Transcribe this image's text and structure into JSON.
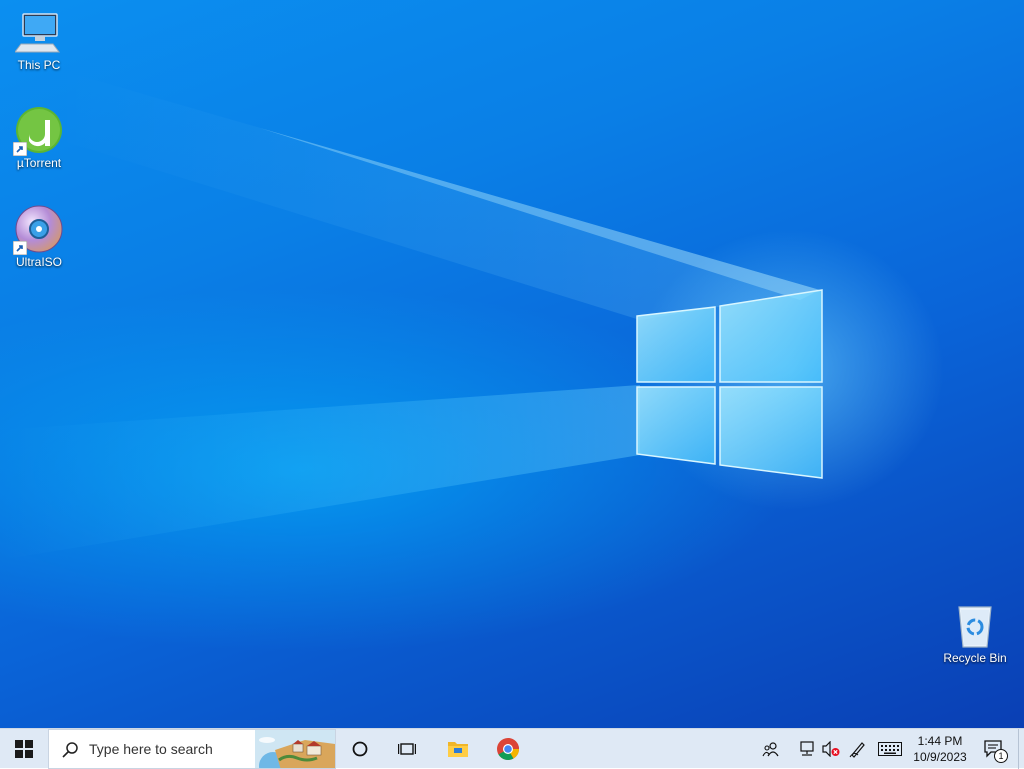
{
  "desktop": {
    "icons": [
      {
        "label": "This PC"
      },
      {
        "label": "µTorrent"
      },
      {
        "label": "UltraISO"
      },
      {
        "label": "Recycle Bin"
      }
    ]
  },
  "taskbar": {
    "search_placeholder": "Type here to search",
    "pinned": [
      "cortana-circle-icon",
      "task-view-icon",
      "file-explorer-icon",
      "chrome-icon"
    ],
    "tray_icons": [
      "people-icon",
      "network-icon",
      "volume-muted-icon",
      "pen-workspace-icon",
      "touch-keyboard-icon"
    ],
    "clock": {
      "time": "1:44 PM",
      "date": "10/9/2023"
    },
    "notification_count": "1"
  },
  "colors": {
    "wallpaper_blue": "#0a7fe6",
    "taskbar_bg": "#dfe9f5"
  }
}
